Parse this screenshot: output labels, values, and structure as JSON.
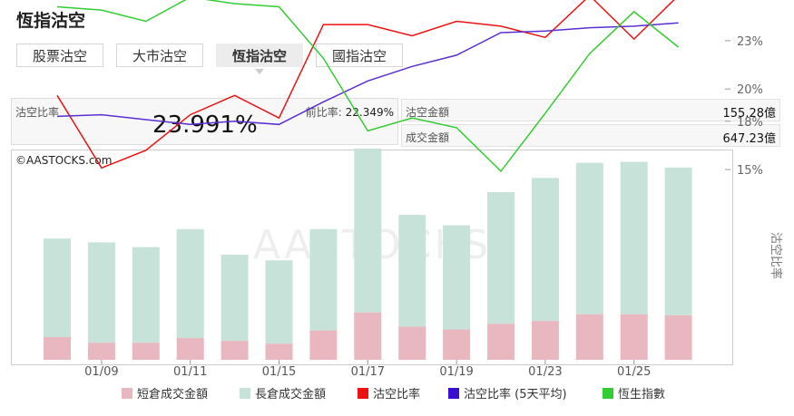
{
  "page": {
    "title": "恆指沽空"
  },
  "tabs": [
    {
      "label": "股票沽空",
      "active": false
    },
    {
      "label": "大市沽空",
      "active": false
    },
    {
      "label": "恆指沽空",
      "active": true
    },
    {
      "label": "國指沽空",
      "active": false
    }
  ],
  "stats": {
    "ratio_label": "沽空比率",
    "ratio_value": "23.991%",
    "prev_label": "前比率:",
    "prev_value": "22.349%",
    "short_amount_label": "沽空金額",
    "short_amount_value": "155.28億",
    "turnover_label": "成交金額",
    "turnover_value": "647.23億"
  },
  "chart_data": {
    "type": "bar",
    "watermark": "©AASTOCKS.com",
    "x_ticks": [
      "01/09",
      "01/11",
      "01/15",
      "01/17",
      "01/19",
      "01/23",
      "01/25"
    ],
    "y_right_label": "沽空比率",
    "y_right_ticks": [
      "23%",
      "20%",
      "18%",
      "15%"
    ],
    "y_right_tick_values": [
      23,
      20,
      18,
      15
    ],
    "y_right_range": [
      14.3,
      26.6
    ],
    "bar_scale_max": 1000,
    "series": [
      {
        "name": "短倉成交金額",
        "kind": "bar",
        "color": "#e8b7c0",
        "values": [
          120,
          90,
          90,
          115,
          100,
          85,
          155,
          250,
          175,
          160,
          190,
          205,
          240,
          240,
          235
        ]
      },
      {
        "name": "長倉成交金額",
        "kind": "bar",
        "color": "#c7e2d8",
        "values": [
          640,
          620,
          595,
          690,
          555,
          525,
          690,
          1115,
          765,
          710,
          885,
          960,
          1040,
          1045,
          1015
        ]
      },
      {
        "name": "沽空比率",
        "kind": "line",
        "color": "#ee1111",
        "values": [
          19.6,
          15.1,
          16.2,
          18.4,
          19.6,
          18.2,
          24.0,
          24.0,
          23.3,
          24.2,
          23.9,
          23.2,
          25.8,
          23.1,
          25.8
        ]
      },
      {
        "name": "沽空比率 (5天平均)",
        "kind": "line",
        "color": "#5a2fd0",
        "values": [
          18.3,
          18.4,
          18.1,
          17.8,
          18.0,
          17.8,
          19.2,
          20.5,
          21.4,
          22.1,
          23.5,
          23.6,
          23.8,
          23.9,
          24.1
        ]
      },
      {
        "name": "恆生指數",
        "kind": "line",
        "color": "#33cc33",
        "values": [
          25.1,
          24.9,
          24.2,
          25.7,
          25.3,
          25.1,
          21.9,
          17.4,
          18.2,
          17.6,
          14.9,
          18.5,
          22.2,
          24.8,
          22.6
        ]
      }
    ]
  }
}
